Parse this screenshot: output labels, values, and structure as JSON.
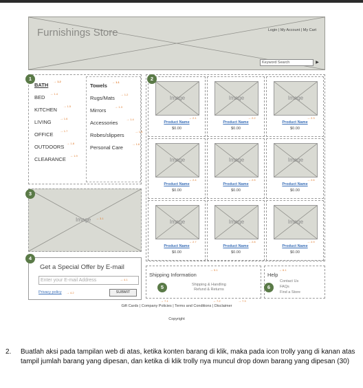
{
  "header": {
    "store_title": "Furnishings Store",
    "login": "Login",
    "my_account": "My Account",
    "my_cart": "My Cart",
    "separator": " | ",
    "search_placeholder": "Keyword Search",
    "search_go_icon": "play-triangle-icon"
  },
  "categories": [
    {
      "label": "BATH",
      "active": true,
      "note": "1.2"
    },
    {
      "label": "BED",
      "note": "1.4"
    },
    {
      "label": "KITCHEN",
      "note": "1.5"
    },
    {
      "label": "LIVING",
      "note": "1.6"
    },
    {
      "label": "OFFICE",
      "note": "1.7"
    },
    {
      "label": "OUTDOORS",
      "note": "1.8"
    },
    {
      "label": "CLEARANCE",
      "note": "1.9"
    }
  ],
  "subcategories": [
    {
      "label": "Towels",
      "bold": true,
      "note": "1.1"
    },
    {
      "label": "Rugs/Mats",
      "note": "1.2"
    },
    {
      "label": "Mirrors",
      "note": "1.3"
    },
    {
      "label": "Accessories",
      "note": "1.4"
    },
    {
      "label": "Robes/slippers",
      "note": "1.5"
    },
    {
      "label": "Personal Care",
      "note": "1.6"
    }
  ],
  "badges": [
    "1",
    "2",
    "3",
    "4",
    "5",
    "6"
  ],
  "promo": {
    "image_label": "Image",
    "note": "3.1"
  },
  "products": [
    {
      "image": "Image",
      "name": "Product Name",
      "price": "$0.00",
      "note": "2.1"
    },
    {
      "image": "Image",
      "name": "Product Name",
      "price": "$0.00",
      "note": "2.2"
    },
    {
      "image": "Image",
      "name": "Product Name",
      "price": "$0.00",
      "note": "2.3"
    },
    {
      "image": "Image",
      "name": "Product Name",
      "price": "$0.00",
      "note": "2.4"
    },
    {
      "image": "Image",
      "name": "Product Name",
      "price": "$0.00",
      "note": "2.5"
    },
    {
      "image": "Image",
      "name": "Product Name",
      "price": "$0.00",
      "note": "2.6"
    },
    {
      "image": "Image",
      "name": "Product Name",
      "price": "$0.00",
      "note": "2.7"
    },
    {
      "image": "Image",
      "name": "Product Name",
      "price": "$0.00",
      "note": "2.8"
    },
    {
      "image": "Image",
      "name": "Product Name",
      "price": "$0.00",
      "note": "2.9"
    }
  ],
  "email_offer": {
    "title": "Get a Special Offer by E-mail",
    "placeholder": "Enter your E-mail Address",
    "privacy": "Privacy policy",
    "submit": "SUBMIT",
    "note_input": "4.1",
    "note_privacy": "4.2"
  },
  "shipping": {
    "title": "Shipping Information",
    "link1": "Shipping & Handling",
    "link2": "Refund & Returns",
    "note": "5.1"
  },
  "help": {
    "title": "Help",
    "link1": "Contact Us",
    "link2": "FAQs",
    "link3": "Find a Store",
    "note": "6.1"
  },
  "footer": {
    "links": "Gift Cards | Company Policies | Terms and Conditions | Disclaimer",
    "copyright": "Copyright",
    "notes": [
      "7.1",
      "7.2",
      "7.3"
    ]
  },
  "question": {
    "number": "2.",
    "text": "Buatlah aksi pada tampilan web di atas, ketika konten barang di klik, maka pada icon trolly yang di kanan atas tampil jumlah barang yang dipesan, dan ketika di klik trolly nya muncul drop down barang yang dipesan (30)"
  },
  "colors": {
    "wire_fill": "#d9dad3",
    "badge": "#5a7a47",
    "annotation": "#e07a2a",
    "link": "#3a6fb8"
  }
}
